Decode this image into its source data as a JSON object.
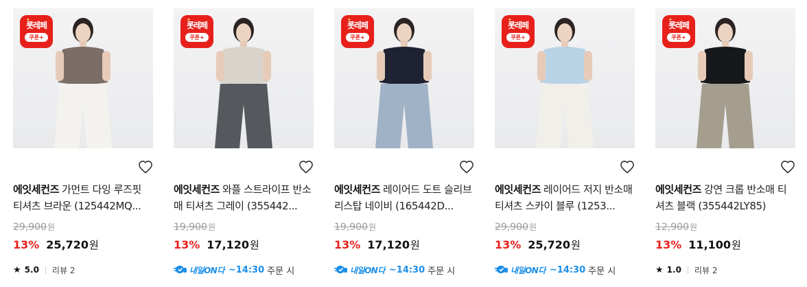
{
  "badge": {
    "top": "롯레페",
    "bottom": "쿠폰+"
  },
  "products": [
    {
      "brand": "에잇세컨즈",
      "name": "가먼트 다잉 루즈핏 티셔츠 브라운 (125442MQ...",
      "original_price": "29,900",
      "currency": "원",
      "discount_rate": "13%",
      "sale_price": "25,720",
      "footer_type": "rating",
      "rating": "5.0",
      "reviews": "리뷰 2",
      "top_color": "#7a6e66",
      "bottom_color": "#f4f2ee"
    },
    {
      "brand": "에잇세컨즈",
      "name": "와플 스트라이프 반소매 티셔츠 그레이 (355442...",
      "original_price": "19,900",
      "currency": "원",
      "discount_rate": "13%",
      "sale_price": "17,120",
      "footer_type": "delivery",
      "delivery_brand": "내일ON다",
      "delivery_time": "~14:30",
      "delivery_suffix": "주문 시",
      "top_color": "#d9d4cb",
      "bottom_color": "#55585c"
    },
    {
      "brand": "에잇세컨즈",
      "name": "레이어드 도트 슬리브리스탑 네이비 (165442D...",
      "original_price": "19,900",
      "currency": "원",
      "discount_rate": "13%",
      "sale_price": "17,120",
      "footer_type": "delivery",
      "delivery_brand": "내일ON다",
      "delivery_time": "~14:30",
      "delivery_suffix": "주문 시",
      "top_color": "#1e2233",
      "bottom_color": "#9fb2c6"
    },
    {
      "brand": "에잇세컨즈",
      "name": "레이어드 저지 반소매 티셔츠 스카이 블루 (1253...",
      "original_price": "29,900",
      "currency": "원",
      "discount_rate": "13%",
      "sale_price": "25,720",
      "footer_type": "delivery",
      "delivery_brand": "내일ON다",
      "delivery_time": "~14:30",
      "delivery_suffix": "주문 시",
      "top_color": "#b9d3e6",
      "bottom_color": "#f1efea"
    },
    {
      "brand": "에잇세컨즈",
      "name": "강연 크롭 반소매 티셔츠 블랙 (355442LY85)",
      "original_price": "12,900",
      "currency": "원",
      "discount_rate": "13%",
      "sale_price": "11,100",
      "footer_type": "rating",
      "rating": "1.0",
      "reviews": "리뷰 2",
      "top_color": "#17181b",
      "bottom_color": "#a59e8e"
    }
  ],
  "colors": {
    "discount_red": "#e8201b",
    "delivery_blue": "#1a8ee8",
    "strike_gray": "#9a9a9a"
  },
  "icons": {
    "wishlist": "heart-outline-icon",
    "rating": "star-icon",
    "delivery": "delivery-truck-icon"
  }
}
